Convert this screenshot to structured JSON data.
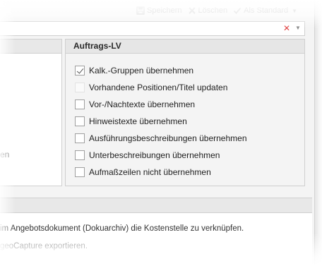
{
  "toolbar": {
    "save_label": "Speichern",
    "delete_label": "Löschen",
    "default_label": "Als Standard"
  },
  "left_panel": {
    "partial_text": "en"
  },
  "group": {
    "title": "Auftrags-LV",
    "options": [
      {
        "label": "Kalk.-Gruppen übernehmen",
        "checked": true,
        "enabled": true
      },
      {
        "label": "Vorhandene Positionen/Titel updaten",
        "checked": false,
        "enabled": false
      },
      {
        "label": "Vor-/Nachtexte übernehmen",
        "checked": false,
        "enabled": true
      },
      {
        "label": "Hinweistexte übernehmen",
        "checked": false,
        "enabled": true
      },
      {
        "label": "Ausführungsbeschreibungen übernehmen",
        "checked": false,
        "enabled": true
      },
      {
        "label": "Unterbeschreibungen übernehmen",
        "checked": false,
        "enabled": true
      },
      {
        "label": "Aufmaßzeilen nicht übernehmen",
        "checked": false,
        "enabled": true
      }
    ]
  },
  "bottom": {
    "line1": "im Angebotsdokument (Dokuarchiv) die Kostenstelle zu verknüpfen.",
    "line2": "geoCapture exportieren."
  }
}
